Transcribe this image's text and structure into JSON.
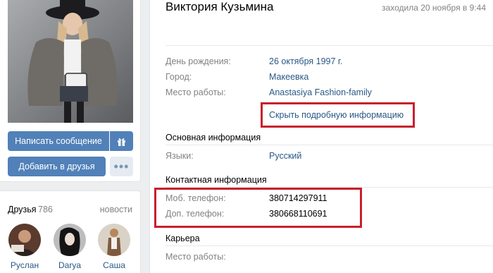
{
  "left": {
    "photo_alt": "",
    "send_message": "Написать сообщение",
    "gift_icon": "gift-icon",
    "add_friend": "Добавить в друзья",
    "more": "•••"
  },
  "friends": {
    "title": "Друзья",
    "count": "786",
    "news": "новости",
    "items": [
      {
        "name": "Руслан"
      },
      {
        "name": "Darya"
      },
      {
        "name": "Саша"
      }
    ]
  },
  "profile": {
    "name": "Виктория Кузьмина",
    "last_seen": "заходила 20 ноября в 9:44",
    "rows": [
      {
        "label": "День рождения:",
        "value": "26 октября 1997 г."
      },
      {
        "label": "Город:",
        "value": "Макеевка"
      },
      {
        "label": "Место работы:",
        "value": "Anastasiya Fashion-family"
      }
    ],
    "toggle_details": "Скрыть подробную информацию",
    "basic_title": "Основная информация",
    "languages_label": "Языки:",
    "languages_value": "Русский",
    "contacts_title": "Контактная информация",
    "mobile_label": "Моб. телефон:",
    "mobile_value": "380714297911",
    "extra_label": "Доп. телефон:",
    "extra_value": "380668110691",
    "career_title": "Карьера",
    "career_work_label": "Место работы:"
  },
  "colors": {
    "accent": "#5181b8",
    "link": "#2a5885",
    "highlight": "#c8202c"
  }
}
